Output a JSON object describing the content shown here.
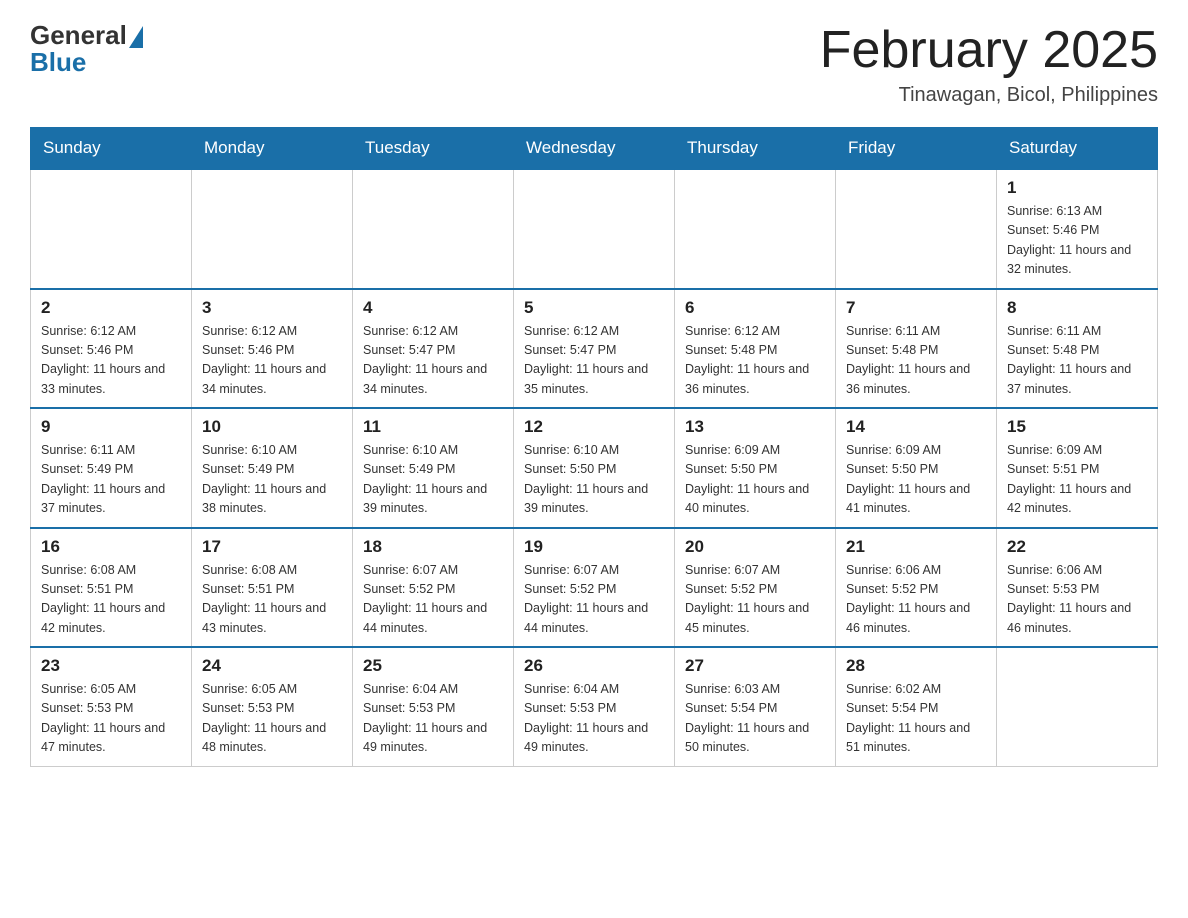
{
  "header": {
    "logo_general": "General",
    "logo_blue": "Blue",
    "month_title": "February 2025",
    "location": "Tinawagan, Bicol, Philippines"
  },
  "days_of_week": [
    "Sunday",
    "Monday",
    "Tuesday",
    "Wednesday",
    "Thursday",
    "Friday",
    "Saturday"
  ],
  "weeks": [
    {
      "days": [
        {
          "date": "",
          "info": ""
        },
        {
          "date": "",
          "info": ""
        },
        {
          "date": "",
          "info": ""
        },
        {
          "date": "",
          "info": ""
        },
        {
          "date": "",
          "info": ""
        },
        {
          "date": "",
          "info": ""
        },
        {
          "date": "1",
          "info": "Sunrise: 6:13 AM\nSunset: 5:46 PM\nDaylight: 11 hours and 32 minutes."
        }
      ]
    },
    {
      "days": [
        {
          "date": "2",
          "info": "Sunrise: 6:12 AM\nSunset: 5:46 PM\nDaylight: 11 hours and 33 minutes."
        },
        {
          "date": "3",
          "info": "Sunrise: 6:12 AM\nSunset: 5:46 PM\nDaylight: 11 hours and 34 minutes."
        },
        {
          "date": "4",
          "info": "Sunrise: 6:12 AM\nSunset: 5:47 PM\nDaylight: 11 hours and 34 minutes."
        },
        {
          "date": "5",
          "info": "Sunrise: 6:12 AM\nSunset: 5:47 PM\nDaylight: 11 hours and 35 minutes."
        },
        {
          "date": "6",
          "info": "Sunrise: 6:12 AM\nSunset: 5:48 PM\nDaylight: 11 hours and 36 minutes."
        },
        {
          "date": "7",
          "info": "Sunrise: 6:11 AM\nSunset: 5:48 PM\nDaylight: 11 hours and 36 minutes."
        },
        {
          "date": "8",
          "info": "Sunrise: 6:11 AM\nSunset: 5:48 PM\nDaylight: 11 hours and 37 minutes."
        }
      ]
    },
    {
      "days": [
        {
          "date": "9",
          "info": "Sunrise: 6:11 AM\nSunset: 5:49 PM\nDaylight: 11 hours and 37 minutes."
        },
        {
          "date": "10",
          "info": "Sunrise: 6:10 AM\nSunset: 5:49 PM\nDaylight: 11 hours and 38 minutes."
        },
        {
          "date": "11",
          "info": "Sunrise: 6:10 AM\nSunset: 5:49 PM\nDaylight: 11 hours and 39 minutes."
        },
        {
          "date": "12",
          "info": "Sunrise: 6:10 AM\nSunset: 5:50 PM\nDaylight: 11 hours and 39 minutes."
        },
        {
          "date": "13",
          "info": "Sunrise: 6:09 AM\nSunset: 5:50 PM\nDaylight: 11 hours and 40 minutes."
        },
        {
          "date": "14",
          "info": "Sunrise: 6:09 AM\nSunset: 5:50 PM\nDaylight: 11 hours and 41 minutes."
        },
        {
          "date": "15",
          "info": "Sunrise: 6:09 AM\nSunset: 5:51 PM\nDaylight: 11 hours and 42 minutes."
        }
      ]
    },
    {
      "days": [
        {
          "date": "16",
          "info": "Sunrise: 6:08 AM\nSunset: 5:51 PM\nDaylight: 11 hours and 42 minutes."
        },
        {
          "date": "17",
          "info": "Sunrise: 6:08 AM\nSunset: 5:51 PM\nDaylight: 11 hours and 43 minutes."
        },
        {
          "date": "18",
          "info": "Sunrise: 6:07 AM\nSunset: 5:52 PM\nDaylight: 11 hours and 44 minutes."
        },
        {
          "date": "19",
          "info": "Sunrise: 6:07 AM\nSunset: 5:52 PM\nDaylight: 11 hours and 44 minutes."
        },
        {
          "date": "20",
          "info": "Sunrise: 6:07 AM\nSunset: 5:52 PM\nDaylight: 11 hours and 45 minutes."
        },
        {
          "date": "21",
          "info": "Sunrise: 6:06 AM\nSunset: 5:52 PM\nDaylight: 11 hours and 46 minutes."
        },
        {
          "date": "22",
          "info": "Sunrise: 6:06 AM\nSunset: 5:53 PM\nDaylight: 11 hours and 46 minutes."
        }
      ]
    },
    {
      "days": [
        {
          "date": "23",
          "info": "Sunrise: 6:05 AM\nSunset: 5:53 PM\nDaylight: 11 hours and 47 minutes."
        },
        {
          "date": "24",
          "info": "Sunrise: 6:05 AM\nSunset: 5:53 PM\nDaylight: 11 hours and 48 minutes."
        },
        {
          "date": "25",
          "info": "Sunrise: 6:04 AM\nSunset: 5:53 PM\nDaylight: 11 hours and 49 minutes."
        },
        {
          "date": "26",
          "info": "Sunrise: 6:04 AM\nSunset: 5:53 PM\nDaylight: 11 hours and 49 minutes."
        },
        {
          "date": "27",
          "info": "Sunrise: 6:03 AM\nSunset: 5:54 PM\nDaylight: 11 hours and 50 minutes."
        },
        {
          "date": "28",
          "info": "Sunrise: 6:02 AM\nSunset: 5:54 PM\nDaylight: 11 hours and 51 minutes."
        },
        {
          "date": "",
          "info": ""
        }
      ]
    }
  ]
}
